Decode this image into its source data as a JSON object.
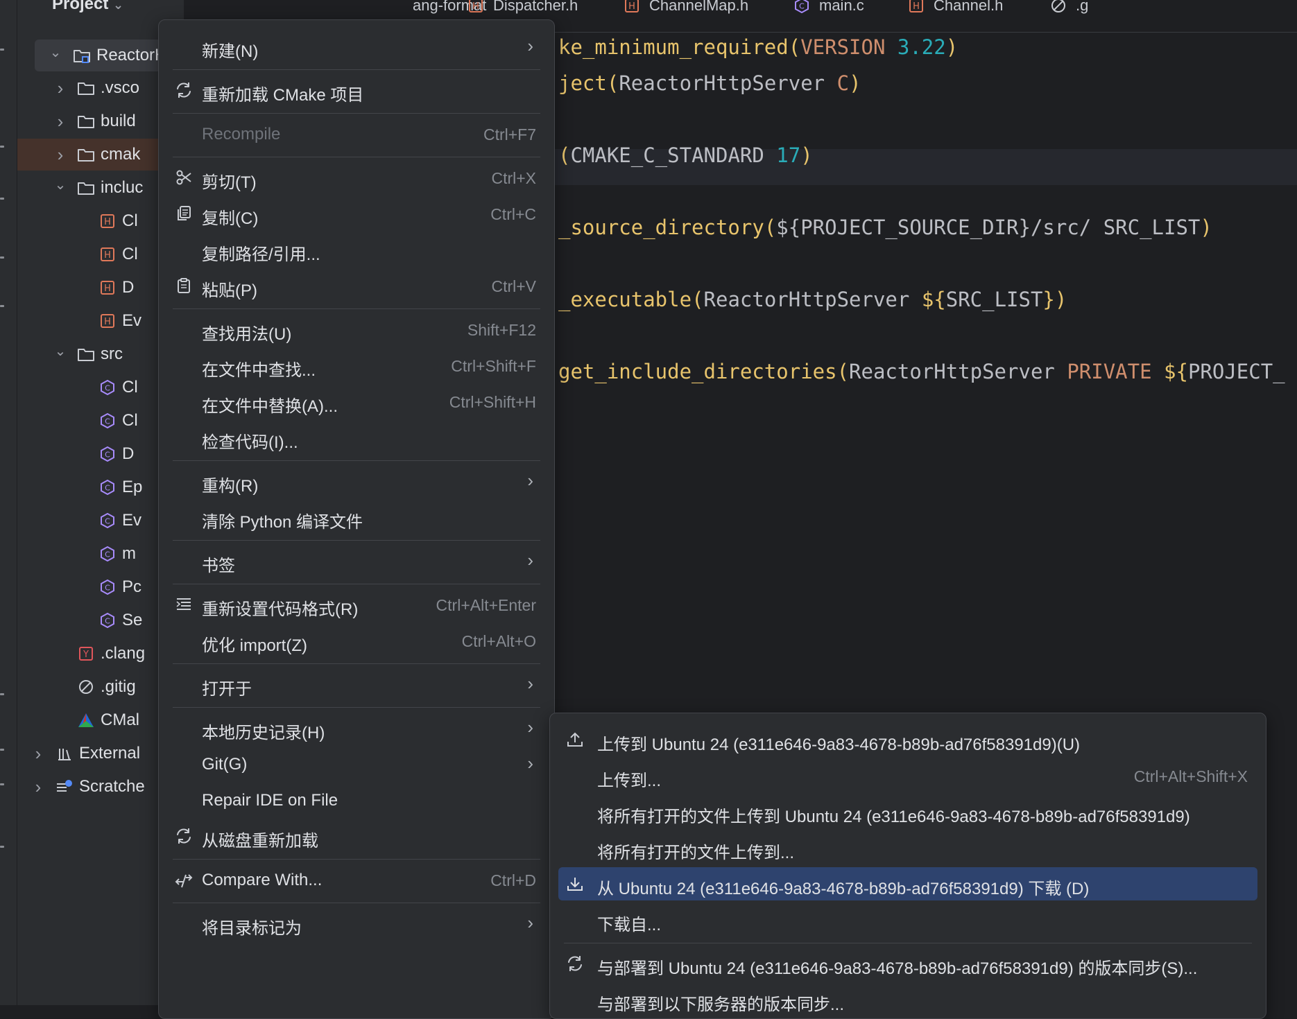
{
  "project_panel": {
    "title": "Project",
    "tree": [
      {
        "label": "ReactorH",
        "icon": "project-folder-icon",
        "state": "expanded"
      },
      {
        "label": ".vsco",
        "icon": "folder-icon",
        "state": "collapsed"
      },
      {
        "label": "build",
        "icon": "folder-icon",
        "state": "collapsed"
      },
      {
        "label": "cmak",
        "icon": "folder-icon",
        "state": "collapsed"
      },
      {
        "label": "incluc",
        "icon": "folder-icon",
        "state": "expanded"
      },
      {
        "label": "Cl",
        "icon": "header-file-icon"
      },
      {
        "label": "Cl",
        "icon": "header-file-icon"
      },
      {
        "label": "D",
        "icon": "header-file-icon"
      },
      {
        "label": "Ev",
        "icon": "header-file-icon"
      },
      {
        "label": "src",
        "icon": "folder-icon",
        "state": "expanded"
      },
      {
        "label": "Cl",
        "icon": "c-file-icon"
      },
      {
        "label": "Cl",
        "icon": "c-file-icon"
      },
      {
        "label": "D",
        "icon": "c-file-icon"
      },
      {
        "label": "Ep",
        "icon": "c-file-icon"
      },
      {
        "label": "Ev",
        "icon": "c-file-icon"
      },
      {
        "label": "m",
        "icon": "c-file-icon"
      },
      {
        "label": "Pc",
        "icon": "c-file-icon"
      },
      {
        "label": "Se",
        "icon": "c-file-icon"
      },
      {
        "label": ".clang",
        "icon": "yaml-file-icon"
      },
      {
        "label": ".gitig",
        "icon": "ignore-file-icon"
      },
      {
        "label": "CMal",
        "icon": "cmake-icon"
      },
      {
        "label": "External",
        "icon": "library-icon",
        "state": "collapsed"
      },
      {
        "label": "Scratche",
        "icon": "scratches-icon",
        "state": "collapsed"
      }
    ]
  },
  "tabs": [
    {
      "label": "ang-format",
      "icon": "none"
    },
    {
      "label": "Dispatcher.h",
      "icon": "header-file-icon"
    },
    {
      "label": "ChannelMap.h",
      "icon": "header-file-icon"
    },
    {
      "label": "main.c",
      "icon": "c-file-icon"
    },
    {
      "label": "Channel.h",
      "icon": "header-file-icon"
    },
    {
      "label": ".g",
      "icon": "ignore-file-icon"
    }
  ],
  "editor": {
    "lines": [
      {
        "parts": [
          [
            "fn",
            "ke_minimum_required"
          ],
          [
            "br",
            "("
          ],
          [
            "kw",
            "VERSION "
          ],
          [
            "num",
            "3.22"
          ],
          [
            "br",
            ")"
          ]
        ]
      },
      {
        "parts": [
          [
            "fn",
            "ject"
          ],
          [
            "br",
            "("
          ],
          [
            "var",
            "ReactorHttpServer "
          ],
          [
            "kw",
            "C"
          ],
          [
            "br",
            ")"
          ]
        ]
      },
      {
        "parts": []
      },
      {
        "parts": [
          [
            "br",
            "("
          ],
          [
            "var",
            "CMAKE_C_STANDARD "
          ],
          [
            "num",
            "17"
          ],
          [
            "br",
            ")"
          ]
        ]
      },
      {
        "parts": []
      },
      {
        "parts": [
          [
            "fn",
            "_source_directory"
          ],
          [
            "br",
            "("
          ],
          [
            "var",
            "${"
          ],
          [
            "var",
            "PROJECT_SOURCE_DIR"
          ],
          [
            "var",
            "}"
          ],
          [
            "var",
            "/src/ SRC_LIST"
          ],
          [
            "br",
            ")"
          ]
        ]
      },
      {
        "parts": []
      },
      {
        "parts": [
          [
            "fn",
            "_executable"
          ],
          [
            "br",
            "("
          ],
          [
            "var",
            "ReactorHttpServer "
          ],
          [
            "br",
            "${"
          ],
          [
            "var",
            "SRC_LIST"
          ],
          [
            "br",
            "}"
          ],
          [
            "br",
            ")"
          ]
        ]
      },
      {
        "parts": []
      },
      {
        "parts": [
          [
            "fn",
            "get_include_directories"
          ],
          [
            "br",
            "("
          ],
          [
            "var",
            "ReactorHttpServer "
          ],
          [
            "kw",
            "PRIVATE "
          ],
          [
            "br",
            "${"
          ],
          [
            "var",
            "PROJECT_"
          ]
        ]
      }
    ]
  },
  "context_menu": {
    "items": [
      {
        "label": "新建(N)",
        "shortcut": "",
        "arrow": true,
        "icon": ""
      },
      {
        "sep": true
      },
      {
        "label": "重新加载 CMake 项目",
        "shortcut": "",
        "icon": "reload-icon"
      },
      {
        "sep": true
      },
      {
        "label": "Recompile",
        "shortcut": "Ctrl+F7",
        "disabled": true,
        "icon": ""
      },
      {
        "sep": true
      },
      {
        "label": "剪切(T)",
        "shortcut": "Ctrl+X",
        "icon": "scissors-icon"
      },
      {
        "label": "复制(C)",
        "shortcut": "Ctrl+C",
        "icon": "copy-icon"
      },
      {
        "label": "复制路径/引用...",
        "shortcut": "",
        "icon": ""
      },
      {
        "label": "粘贴(P)",
        "shortcut": "Ctrl+V",
        "icon": "paste-icon"
      },
      {
        "sep": true
      },
      {
        "label": "查找用法(U)",
        "shortcut": "Shift+F12",
        "icon": ""
      },
      {
        "label": "在文件中查找...",
        "shortcut": "Ctrl+Shift+F",
        "icon": ""
      },
      {
        "label": "在文件中替换(A)...",
        "shortcut": "Ctrl+Shift+H",
        "icon": ""
      },
      {
        "label": "检查代码(I)...",
        "shortcut": "",
        "icon": ""
      },
      {
        "sep": true
      },
      {
        "label": "重构(R)",
        "shortcut": "",
        "arrow": true,
        "icon": ""
      },
      {
        "label": "清除 Python 编译文件",
        "shortcut": "",
        "icon": ""
      },
      {
        "sep": true
      },
      {
        "label": "书签",
        "shortcut": "",
        "arrow": true,
        "icon": ""
      },
      {
        "sep": true
      },
      {
        "label": "重新设置代码格式(R)",
        "shortcut": "Ctrl+Alt+Enter",
        "icon": "reformat-icon"
      },
      {
        "label": "优化 import(Z)",
        "shortcut": "Ctrl+Alt+O",
        "icon": ""
      },
      {
        "sep": true
      },
      {
        "label": "打开于",
        "shortcut": "",
        "arrow": true,
        "icon": ""
      },
      {
        "sep": true
      },
      {
        "label": "本地历史记录(H)",
        "shortcut": "",
        "arrow": true,
        "icon": ""
      },
      {
        "label": "Git(G)",
        "shortcut": "",
        "arrow": true,
        "icon": ""
      },
      {
        "label": "Repair IDE on File",
        "shortcut": "",
        "icon": ""
      },
      {
        "label": "从磁盘重新加载",
        "shortcut": "",
        "icon": "reload-icon"
      },
      {
        "sep": true
      },
      {
        "label": "Compare With...",
        "shortcut": "Ctrl+D",
        "icon": "compare-icon"
      },
      {
        "sep": true
      },
      {
        "label": "将目录标记为",
        "shortcut": "",
        "arrow": true,
        "icon": ""
      }
    ]
  },
  "deployment_submenu": {
    "items": [
      {
        "label": "上传到 Ubuntu 24 (e311e646-9a83-4678-b89b-ad76f58391d9)(U)",
        "shortcut": "",
        "icon": "upload-icon"
      },
      {
        "label": "上传到...",
        "shortcut": "Ctrl+Alt+Shift+X",
        "icon": ""
      },
      {
        "label": "将所有打开的文件上传到 Ubuntu 24 (e311e646-9a83-4678-b89b-ad76f58391d9)",
        "shortcut": "",
        "icon": ""
      },
      {
        "label": "将所有打开的文件上传到...",
        "shortcut": "",
        "icon": ""
      },
      {
        "label": "从 Ubuntu 24 (e311e646-9a83-4678-b89b-ad76f58391d9) 下载 (D)",
        "shortcut": "",
        "icon": "download-icon",
        "active": true
      },
      {
        "label": "下载自...",
        "shortcut": "",
        "icon": ""
      },
      {
        "sep": true
      },
      {
        "label": "与部署到 Ubuntu 24 (e311e646-9a83-4678-b89b-ad76f58391d9) 的版本同步(S)...",
        "shortcut": "",
        "icon": "sync-icon"
      },
      {
        "label": "与部署到以下服务器的版本同步...",
        "shortcut": "",
        "icon": ""
      }
    ]
  },
  "colors": {
    "accent": "#2e436e",
    "folder_highlight": "#45322b",
    "function": "#e8c46c",
    "number": "#2aacb8",
    "keyword": "#cf8e6d"
  }
}
